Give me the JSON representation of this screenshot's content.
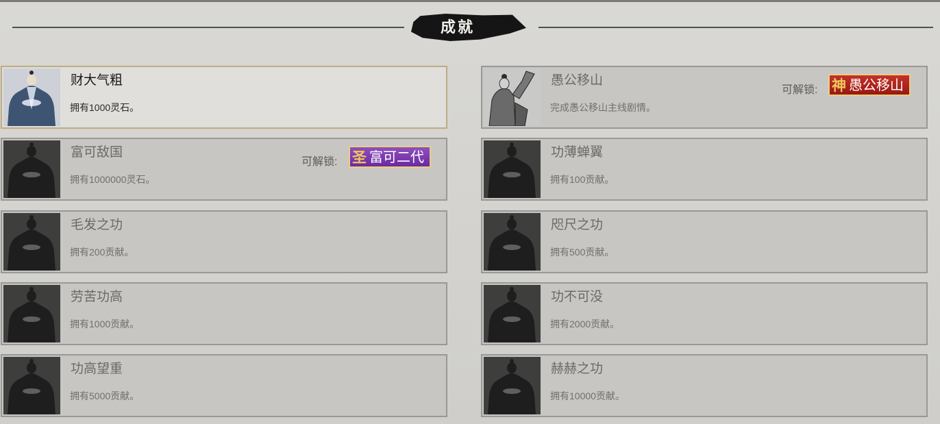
{
  "header": {
    "title": "成就"
  },
  "unlock_label": "可解锁:",
  "colors": {
    "purple_badge": "#7d3cb0",
    "red_badge": "#b3231b",
    "badge_border": "#e8cf82",
    "unlocked_card": "#e0dfdb",
    "locked_card": "#c7c6c3"
  },
  "achievements": [
    {
      "title": "财大气粗",
      "desc": "拥有1000灵石。",
      "state": "unlocked",
      "portrait": "robed-figure-portrait"
    },
    {
      "title": "愚公移山",
      "desc": "完成愚公移山主线剧情。",
      "state": "locked",
      "portrait": "elder-portrait",
      "reward": {
        "glyph": "神",
        "text": "愚公移山",
        "color": "red"
      }
    },
    {
      "title": "富可敌国",
      "desc": "拥有1000000灵石。",
      "state": "locked",
      "portrait": "robed-figure-portrait",
      "reward": {
        "glyph": "圣",
        "text": "富可二代",
        "color": "purple"
      }
    },
    {
      "title": "功薄蝉翼",
      "desc": "拥有100贡献。",
      "state": "locked",
      "portrait": "robed-figure-portrait"
    },
    {
      "title": "毛发之功",
      "desc": "拥有200贡献。",
      "state": "locked",
      "portrait": "robed-figure-portrait"
    },
    {
      "title": "咫尺之功",
      "desc": "拥有500贡献。",
      "state": "locked",
      "portrait": "robed-figure-portrait"
    },
    {
      "title": "劳苦功高",
      "desc": "拥有1000贡献。",
      "state": "locked",
      "portrait": "robed-figure-portrait"
    },
    {
      "title": "功不可没",
      "desc": "拥有2000贡献。",
      "state": "locked",
      "portrait": "robed-figure-portrait"
    },
    {
      "title": "功高望重",
      "desc": "拥有5000贡献。",
      "state": "locked",
      "portrait": "robed-figure-portrait"
    },
    {
      "title": "赫赫之功",
      "desc": "拥有10000贡献。",
      "state": "locked",
      "portrait": "robed-figure-portrait"
    }
  ]
}
